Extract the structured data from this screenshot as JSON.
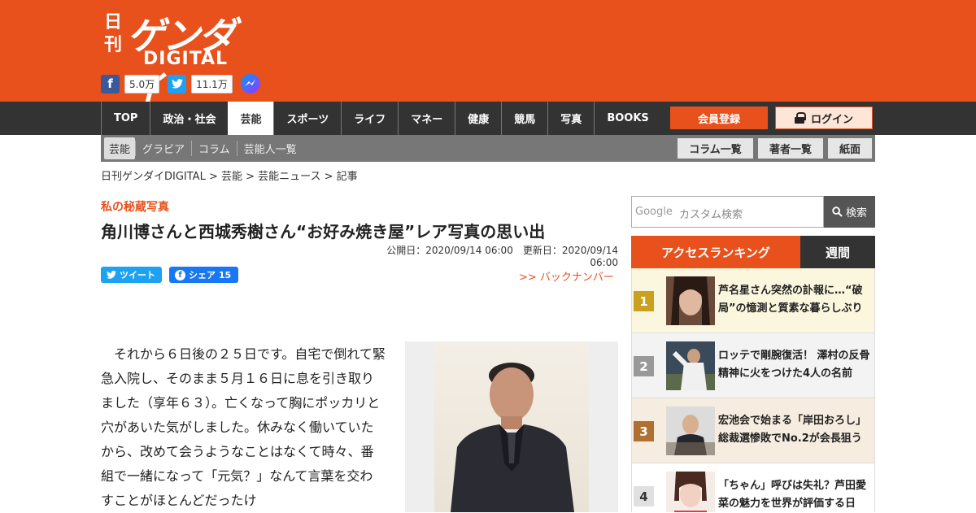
{
  "header": {
    "logo_nikkan": "日刊",
    "logo_gendai": "ゲンダイ",
    "logo_digital": "DIGITAL",
    "facebook_count": "5.0万",
    "twitter_count": "11.1万",
    "brand_color": "#e8501c"
  },
  "nav": {
    "items": [
      "TOP",
      "政治・社会",
      "芸能",
      "スポーツ",
      "ライフ",
      "マネー",
      "健康",
      "競馬",
      "写真",
      "BOOKS"
    ],
    "active": "芸能",
    "member_label": "会員登録",
    "login_label": "ログイン"
  },
  "subnav": {
    "items": [
      "芸能",
      "グラビア",
      "コラム",
      "芸能人一覧"
    ],
    "buttons": [
      "コラム一覧",
      "著者一覧",
      "紙面"
    ]
  },
  "breadcrumb": "日刊ゲンダイDIGITAL > 芸能 > 芸能ニュース > 記事",
  "article": {
    "series": "私の秘蔵写真",
    "title": "角川博さんと西城秀樹さん“お好み焼き屋”レア写真の思い出",
    "dates": "公開日：2020/09/14 06:00　更新日：2020/09/14 06:00",
    "tweet_label": "ツイート",
    "share_label": "シェア 15",
    "backnumber": ">> バックナンバー",
    "body": "　それから６日後の２５日です。自宅で倒れて緊急入院し、そのまま５月１６日に息を引き取りました（享年６３）。亡くなって胸にポッカリと穴があいた気がしました。休みなく働いていたから、改めて会うようなことはなくて時々、番組で一緒になって「元気？」なんて言葉を交わすことがほとんどだったけ"
  },
  "search": {
    "google_label": "Google",
    "placeholder": "カスタム検索",
    "button_label": "検索"
  },
  "ranking": {
    "tab_access": "アクセスランキング",
    "tab_week": "週間",
    "items": [
      {
        "num": "1",
        "text": "芦名星さん突然の訃報に…“破局”の憶測と質素な暮らしぶり",
        "badge_color": "#c9a020",
        "bg": "#fbf6de"
      },
      {
        "num": "2",
        "text": "ロッテで剛腕復活！ 澤村の反骨精神に火をつけた4人の名前",
        "badge_color": "#999999",
        "bg": "#f3f3f3"
      },
      {
        "num": "3",
        "text": "宏池会で始まる「岸田おろし」総裁選惨敗でNo.2が会長狙う",
        "badge_color": "#b07030",
        "bg": "#f7ece0"
      },
      {
        "num": "4",
        "text": "「ちゃん」呼びは失礼？芦田愛菜の魅力を世界が評価する日",
        "badge_color": "#e0e0e0",
        "bg": "#ffffff"
      }
    ]
  }
}
